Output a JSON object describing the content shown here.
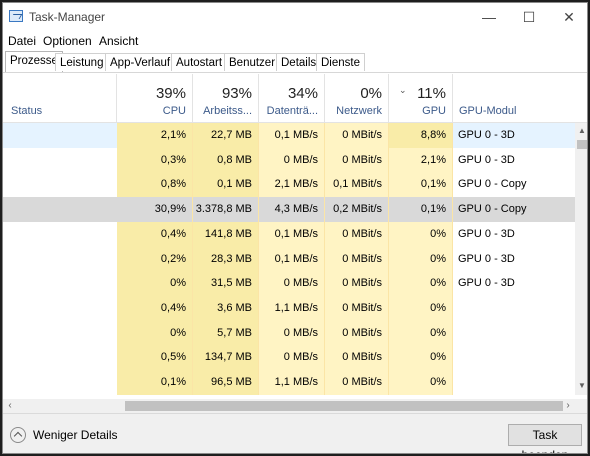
{
  "window": {
    "title": "Task-Manager"
  },
  "menu": [
    "Datei",
    "Optionen",
    "Ansicht"
  ],
  "tabs": [
    "Prozesse",
    "Leistung",
    "App-Verlauf",
    "Autostart",
    "Benutzer",
    "Details",
    "Dienste"
  ],
  "header": {
    "status": "Status",
    "cpu": {
      "pct": "39%",
      "label": "CPU"
    },
    "mem": {
      "pct": "93%",
      "label": "Arbeitss..."
    },
    "disk": {
      "pct": "34%",
      "label": "Datenträ..."
    },
    "net": {
      "pct": "0%",
      "label": "Netzwerk"
    },
    "gpu": {
      "pct": "11%",
      "label": "GPU"
    },
    "gpu_engine": "GPU-Modul"
  },
  "rows": [
    {
      "cpu": "2,1%",
      "mem": "22,7 MB",
      "disk": "0,1 MB/s",
      "net": "0 MBit/s",
      "gpu": "8,8%",
      "engine": "GPU 0 - 3D"
    },
    {
      "cpu": "0,3%",
      "mem": "0,8 MB",
      "disk": "0 MB/s",
      "net": "0 MBit/s",
      "gpu": "2,1%",
      "engine": "GPU 0 - 3D"
    },
    {
      "cpu": "0,8%",
      "mem": "0,1 MB",
      "disk": "2,1 MB/s",
      "net": "0,1 MBit/s",
      "gpu": "0,1%",
      "engine": "GPU 0 - Copy"
    },
    {
      "cpu": "30,9%",
      "mem": "3.378,8 MB",
      "disk": "4,3 MB/s",
      "net": "0,2 MBit/s",
      "gpu": "0,1%",
      "engine": "GPU 0 - Copy"
    },
    {
      "cpu": "0,4%",
      "mem": "141,8 MB",
      "disk": "0,1 MB/s",
      "net": "0 MBit/s",
      "gpu": "0%",
      "engine": "GPU 0 - 3D"
    },
    {
      "cpu": "0,2%",
      "mem": "28,3 MB",
      "disk": "0,1 MB/s",
      "net": "0 MBit/s",
      "gpu": "0%",
      "engine": "GPU 0 - 3D"
    },
    {
      "cpu": "0%",
      "mem": "31,5 MB",
      "disk": "0 MB/s",
      "net": "0 MBit/s",
      "gpu": "0%",
      "engine": "GPU 0 - 3D"
    },
    {
      "cpu": "0,4%",
      "mem": "3,6 MB",
      "disk": "1,1 MB/s",
      "net": "0 MBit/s",
      "gpu": "0%",
      "engine": ""
    },
    {
      "cpu": "0%",
      "mem": "5,7 MB",
      "disk": "0 MB/s",
      "net": "0 MBit/s",
      "gpu": "0%",
      "engine": ""
    },
    {
      "cpu": "0,5%",
      "mem": "134,7 MB",
      "disk": "0 MB/s",
      "net": "0 MBit/s",
      "gpu": "0%",
      "engine": ""
    },
    {
      "cpu": "0,1%",
      "mem": "96,5 MB",
      "disk": "1,1 MB/s",
      "net": "0 MBit/s",
      "gpu": "0%",
      "engine": ""
    }
  ],
  "footer": {
    "less_details": "Weniger Details",
    "end_task": "Task beenden"
  },
  "colors": {
    "heat_light": "#fff4c4",
    "heat_medium": "#f9eca8",
    "row_selected_blue": "#e5f3ff",
    "row_selected_gray": "#d9d9d9"
  }
}
